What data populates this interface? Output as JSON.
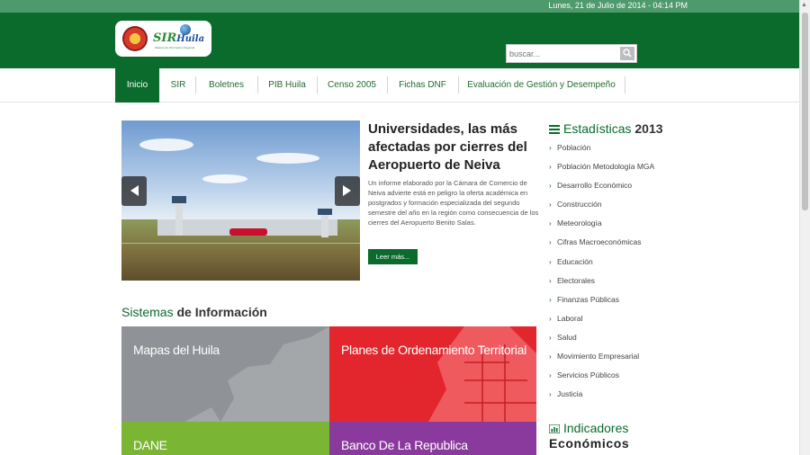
{
  "topbar": {
    "date": "Lunes, 21 de Julio de 2014 - 04:14 PM"
  },
  "header": {
    "logo_text": "SIR",
    "logo_text_b": "Huila",
    "logo_subtitle": "Sistema de Información Regional",
    "search_placeholder": "buscar..."
  },
  "nav": {
    "items": [
      {
        "label": "Inicio",
        "active": true
      },
      {
        "label": "SIR"
      },
      {
        "label": "Boletnes"
      },
      {
        "label": "PIB Huila"
      },
      {
        "label": "Censo 2005"
      },
      {
        "label": "Fichas DNF"
      },
      {
        "label": "Evaluación de Gestión y Desempeño"
      }
    ]
  },
  "news": {
    "title": "Universidades, las más afectadas por cierres del Aeropuerto de Neiva",
    "body": "Un informe elaborado por la Cámara de Comercio de Neiva advierte está en peligro la oferta académica en postgrados y formación especializada del segundo semestre del año en la región como consecuencia de los cierres del Aeropuerto Benito Salas.",
    "read_more": "Leer más..."
  },
  "systems": {
    "heading_a": "Sistemas",
    "heading_b": "de Información",
    "tiles": [
      {
        "label": "Mapas del Huila",
        "color": "#8f9296"
      },
      {
        "label": "Planes de Ordenamiento Territorial",
        "color": "#e3262d"
      },
      {
        "label": "DANE",
        "color": "#7bb534"
      },
      {
        "label": "Banco De La Republica",
        "color": "#8a3a9c"
      }
    ]
  },
  "sidebar": {
    "stats_heading_a": "Estadísticas",
    "stats_heading_b": "2013",
    "stats_icon": "list-icon",
    "stats": [
      "Población",
      "Población Metodología MGA",
      "Desarrollo Económico",
      "Construcción",
      "Meteorología",
      "Cifras Macroeconómicas",
      "Educación",
      "Electorales",
      "Finanzas Públicas",
      "Laboral",
      "Salud",
      "Movimiento Empresarial",
      "Servicios Públicos",
      "Justicia"
    ],
    "indicators_heading_a": "Indicadores",
    "indicators_heading_b": "Económicos",
    "indicators_icon": "bar-chart-icon"
  },
  "colors": {
    "brand_green": "#0a6b2c",
    "topbar_green": "#4e9a6c"
  }
}
